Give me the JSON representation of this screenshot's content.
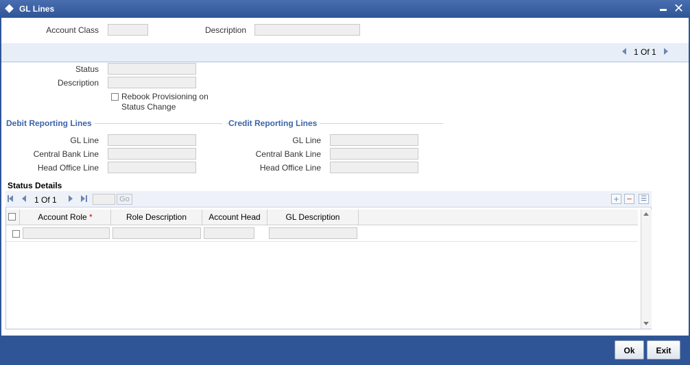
{
  "window": {
    "title": "GL Lines"
  },
  "header": {
    "account_class_label": "Account Class",
    "account_class_value": "",
    "description_label": "Description",
    "description_value": ""
  },
  "record_pager": {
    "text": "1 Of 1"
  },
  "status_section": {
    "status_label": "Status",
    "status_value": "",
    "description_label": "Description",
    "description_value": "",
    "rebook_label_line1": "Rebook Provisioning on",
    "rebook_label_line2": "Status Change",
    "rebook_checked": false
  },
  "debit": {
    "title": "Debit Reporting Lines",
    "gl_line_label": "GL Line",
    "central_bank_label": "Central Bank Line",
    "head_office_label": "Head Office Line"
  },
  "credit": {
    "title": "Credit Reporting Lines",
    "gl_line_label": "GL Line",
    "central_bank_label": "Central Bank Line",
    "head_office_label": "Head Office Line"
  },
  "status_details": {
    "title": "Status Details",
    "pager_text": "1 Of 1",
    "go_label": "Go",
    "columns": [
      "Account Role",
      "Role Description",
      "Account Head",
      "GL Description"
    ],
    "required_marker": "*",
    "rows": [
      {
        "account_role": "",
        "role_description": "",
        "account_head": "",
        "gl_description": ""
      }
    ]
  },
  "footer": {
    "ok_label": "Ok",
    "exit_label": "Exit"
  },
  "icons": {
    "title": "diamond-icon",
    "minimize": "minimize-icon",
    "close": "close-icon",
    "pager_prev": "triangle-left-icon",
    "pager_next": "triangle-right-icon",
    "first": "first-page-icon",
    "prev": "prev-page-icon",
    "next": "next-page-icon",
    "last": "last-page-icon",
    "add": "plus-icon",
    "delete": "minus-icon",
    "view": "list-view-icon"
  },
  "colors": {
    "titlebar": "#2f5597",
    "section_heading": "#3b64a8",
    "required": "#d40000"
  }
}
